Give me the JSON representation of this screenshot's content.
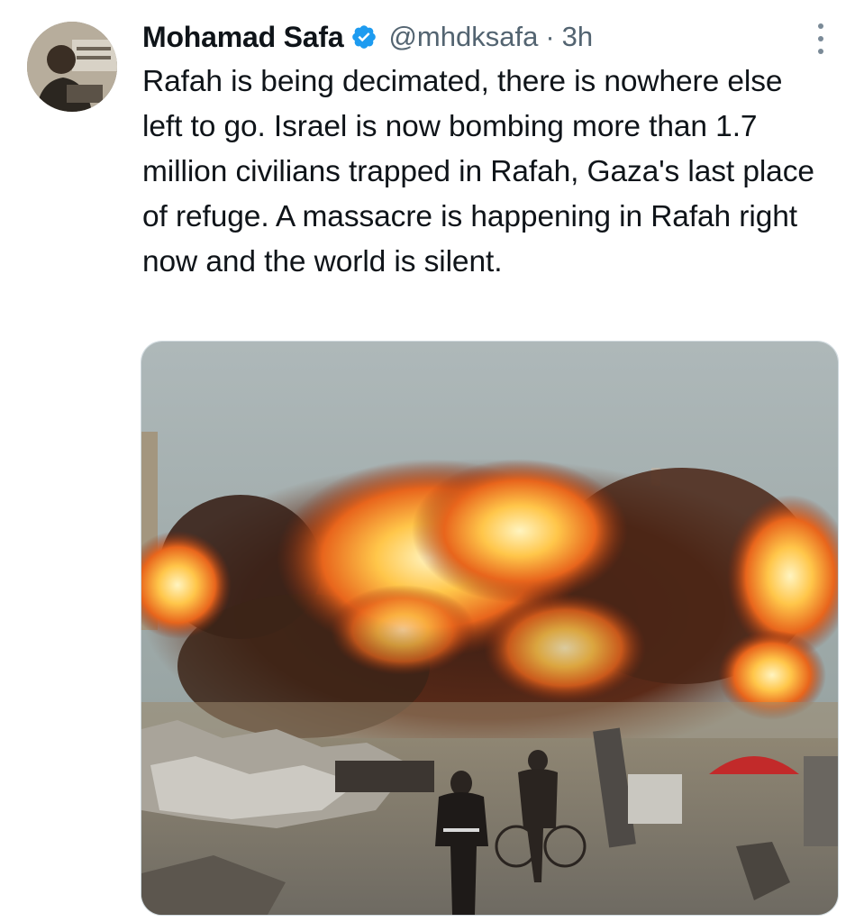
{
  "tweet": {
    "author_name": "Mohamad Safa",
    "handle": "@mhdksafa",
    "separator": "·",
    "time": "3h",
    "text": "Rafah is being decimated, there is nowhere else left to go. Israel is now bombing more than 1.7 million civilians trapped in Rafah, Gaza's last place of refuge. A massacre is happening in Rafah right now and the world is silent."
  },
  "icons": {
    "verified": "verified-badge-icon",
    "more": "more-options-icon"
  },
  "colors": {
    "verified_blue": "#1d9bf0",
    "text_primary": "#0f1419",
    "text_secondary": "#536471"
  }
}
